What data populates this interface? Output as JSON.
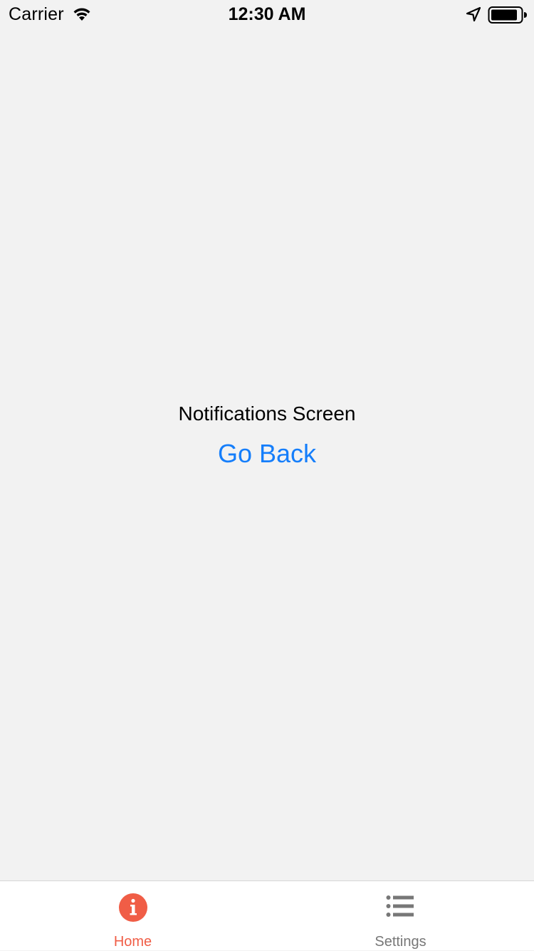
{
  "status_bar": {
    "carrier": "Carrier",
    "time": "12:30 AM",
    "icons": [
      "wifi-icon",
      "location-icon",
      "battery-icon"
    ]
  },
  "screen": {
    "title": "Notifications Screen",
    "go_back_label": "Go Back"
  },
  "tab_bar": {
    "tabs": [
      {
        "label": "Home",
        "icon": "info-icon",
        "active": true
      },
      {
        "label": "Settings",
        "icon": "list-icon",
        "active": false
      }
    ]
  },
  "colors": {
    "background": "#f2f2f2",
    "link": "#157efb",
    "active_tab": "#f05d46",
    "inactive_tab": "#777777"
  }
}
